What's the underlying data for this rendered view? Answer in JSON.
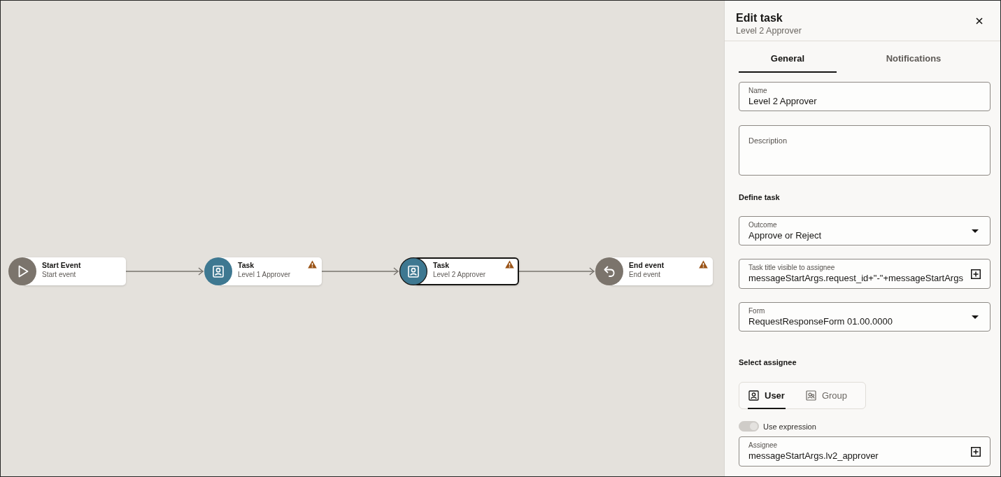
{
  "canvas": {
    "nodes": [
      {
        "kind": "start",
        "title": "Start Event",
        "subtitle": "Start event",
        "warning": false,
        "selected": false
      },
      {
        "kind": "task",
        "title": "Task",
        "subtitle": "Level 1 Approver",
        "warning": true,
        "selected": false
      },
      {
        "kind": "task",
        "title": "Task",
        "subtitle": "Level 2 Approver",
        "warning": true,
        "selected": true
      },
      {
        "kind": "end",
        "title": "End event",
        "subtitle": "End event",
        "warning": true,
        "selected": false
      }
    ]
  },
  "panel": {
    "title": "Edit task",
    "subtitle": "Level 2 Approver",
    "tabs": [
      {
        "label": "General",
        "selected": true
      },
      {
        "label": "Notifications",
        "selected": false
      }
    ],
    "fields": [
      {
        "kind": "text",
        "label": "Name",
        "value": "Level 2 Approver"
      },
      {
        "kind": "textarea",
        "label": "Description"
      }
    ],
    "define_task": {
      "heading": "Define task",
      "fields": [
        {
          "kind": "select",
          "label": "Outcome",
          "value": "Approve or Reject"
        },
        {
          "kind": "expression",
          "label": "Task title visible to assignee",
          "value": "messageStartArgs.request_id+\"-\"+messageStartArgs"
        },
        {
          "kind": "select",
          "label": "Form",
          "value": "RequestResponseForm 01.00.0000"
        }
      ]
    },
    "select_assignee": {
      "heading": "Select assignee",
      "assignee_types": [
        {
          "kind": "user",
          "label": "User",
          "selected": true
        },
        {
          "kind": "group",
          "label": "Group",
          "selected": false
        }
      ],
      "use_expression": {
        "label": "Use expression",
        "on": true,
        "disabled": true
      },
      "fields": [
        {
          "kind": "expression",
          "label": "Assignee",
          "value": "messageStartArgs.lv2_approver"
        }
      ]
    }
  }
}
